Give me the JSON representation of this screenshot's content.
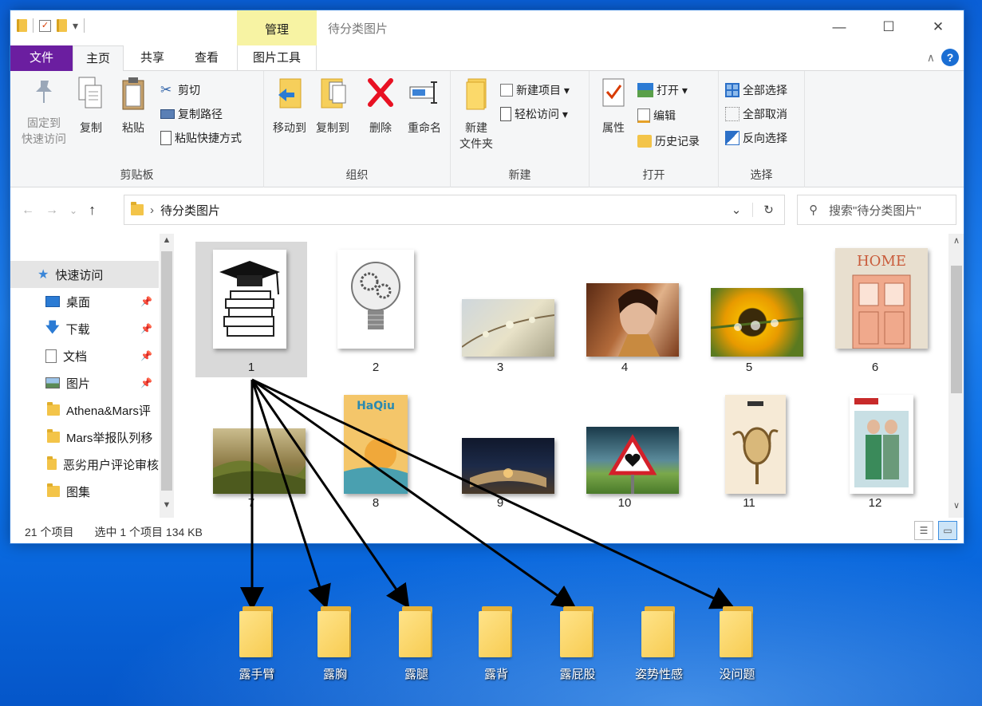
{
  "quick_access_toolbar": {
    "dropdown": "▾"
  },
  "contextual_tab": {
    "label": "管理"
  },
  "window": {
    "title": "待分类图片",
    "minimize": "—",
    "maximize": "☐",
    "close": "✕"
  },
  "tabs": {
    "file": "文件",
    "home": "主页",
    "share": "共享",
    "view": "查看",
    "picture_tools": "图片工具"
  },
  "ribbon": {
    "clipboard": {
      "group": "剪贴板",
      "pin_line1": "固定到",
      "pin_line2": "快速访问",
      "copy": "复制",
      "paste": "粘贴",
      "cut": "剪切",
      "copy_path": "复制路径",
      "paste_shortcut": "粘贴快捷方式"
    },
    "organize": {
      "group": "组织",
      "move_to": "移动到",
      "copy_to": "复制到",
      "delete": "删除",
      "rename": "重命名"
    },
    "new": {
      "group": "新建",
      "new_folder_line1": "新建",
      "new_folder_line2": "文件夹",
      "new_item": "新建项目 ▾",
      "easy_access": "轻松访问 ▾"
    },
    "open": {
      "group": "打开",
      "properties": "属性",
      "open": "打开 ▾",
      "edit": "编辑",
      "history": "历史记录"
    },
    "select": {
      "group": "选择",
      "select_all": "全部选择",
      "select_none": "全部取消",
      "invert": "反向选择"
    }
  },
  "navigation": {
    "back": "←",
    "forward": "→",
    "recent": "⌄",
    "up": "↑",
    "separator": "›",
    "path": "待分类图片",
    "refresh": "↻",
    "dropdown": "⌄",
    "search_placeholder": "搜索\"待分类图片\""
  },
  "sidebar": {
    "items": [
      {
        "label": "快速访问",
        "icon": "star-icon"
      },
      {
        "label": "桌面",
        "icon": "desktop-icon",
        "pinned": true
      },
      {
        "label": "下载",
        "icon": "download-icon",
        "pinned": true
      },
      {
        "label": "文档",
        "icon": "document-icon",
        "pinned": true
      },
      {
        "label": "图片",
        "icon": "picture-icon",
        "pinned": true
      },
      {
        "label": "Athena&Mars评",
        "icon": "folder-icon"
      },
      {
        "label": "Mars举报队列移",
        "icon": "folder-icon"
      },
      {
        "label": "恶劣用户评论审核",
        "icon": "folder-icon"
      },
      {
        "label": "图集",
        "icon": "folder-icon"
      }
    ]
  },
  "files": [
    {
      "label": "1",
      "selected": true
    },
    {
      "label": "2"
    },
    {
      "label": "3"
    },
    {
      "label": "4"
    },
    {
      "label": "5"
    },
    {
      "label": "6"
    },
    {
      "label": "7"
    },
    {
      "label": "8"
    },
    {
      "label": "9"
    },
    {
      "label": "10"
    },
    {
      "label": "11"
    },
    {
      "label": "12"
    }
  ],
  "thumb_text": {
    "home_sign": "HOME",
    "haqiu": "HaQiu"
  },
  "status": {
    "count": "21 个项目",
    "selection": "选中 1 个项目  134 KB"
  },
  "desktop_folders": [
    "露手臂",
    "露胸",
    "露腿",
    "露背",
    "露屁股",
    "姿势性感",
    "没问题"
  ],
  "colors": {
    "file_tab": "#6b1ea0",
    "manage_tab": "#f7f3a3",
    "desktop": "#0b6fe6",
    "folder": "#f3c449"
  }
}
